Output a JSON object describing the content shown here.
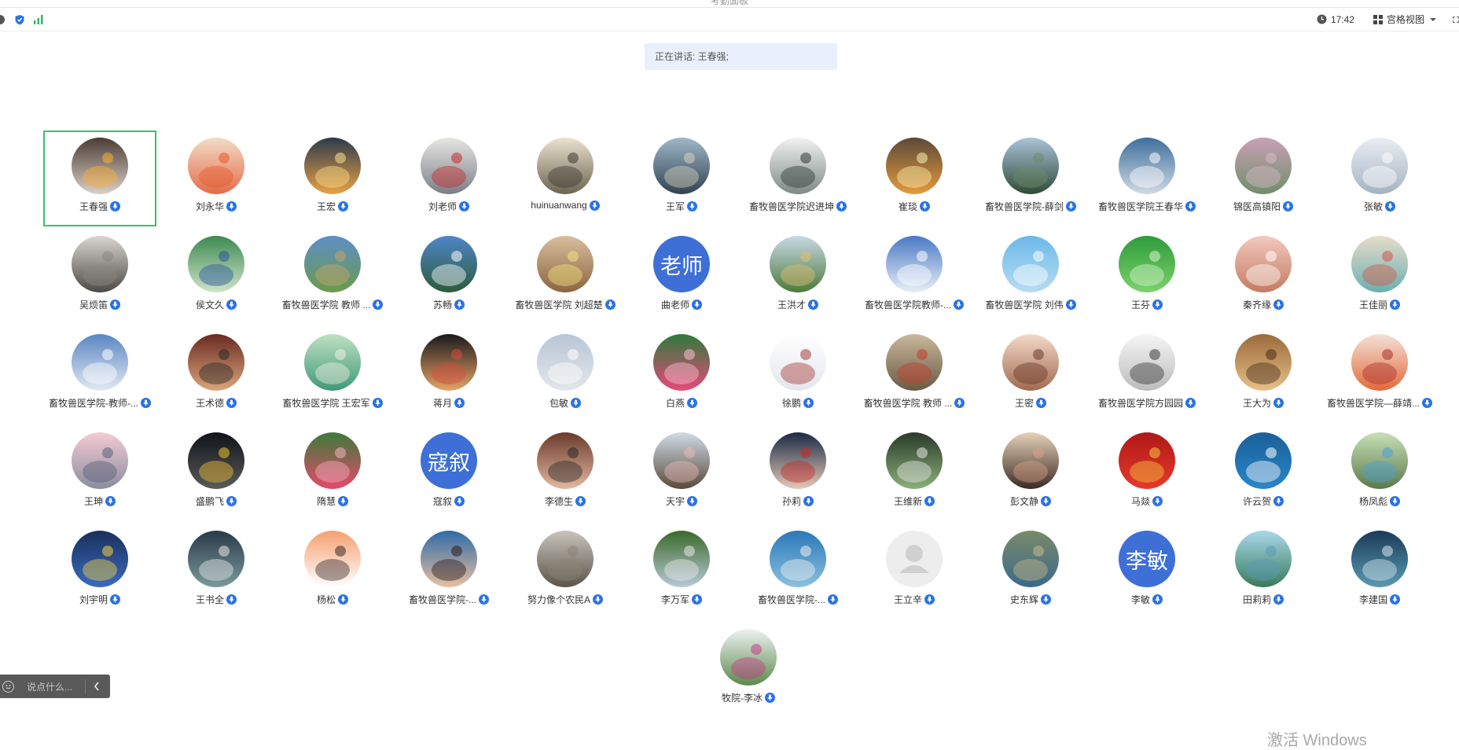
{
  "window": {
    "title": "考勤面板"
  },
  "toolbar": {
    "left_icons": [
      "info-icon",
      "shield-icon",
      "signal-icon"
    ],
    "time": "17:42",
    "view_mode": "宫格视图"
  },
  "banner": {
    "speaking": "正在讲话: 王春强;"
  },
  "participants": [
    {
      "name": "王春强",
      "avatar": {
        "type": "image",
        "c1": "#4a3d35",
        "c2": "#d9d0c8",
        "accent": "#ffb02e"
      }
    },
    {
      "name": "刘永华",
      "avatar": {
        "type": "image",
        "c1": "#f3dcc7",
        "c2": "#e36c4a",
        "accent": "#e65c2c"
      }
    },
    {
      "name": "王宏",
      "avatar": {
        "type": "image",
        "c1": "#2d3a4c",
        "c2": "#e8a145",
        "accent": "#ffe08a"
      }
    },
    {
      "name": "刘老师",
      "avatar": {
        "type": "image",
        "c1": "#e8e6e3",
        "c2": "#7a7f86",
        "accent": "#c52a2a"
      }
    },
    {
      "name": "huinuanwang",
      "avatar": {
        "type": "image",
        "c1": "#ebe3cf",
        "c2": "#6c6352",
        "accent": "#3e3a33"
      }
    },
    {
      "name": "王军",
      "avatar": {
        "type": "image",
        "c1": "#9fb8c8",
        "c2": "#314253",
        "accent": "#d8d0b8"
      }
    },
    {
      "name": "畜牧兽医学院迟进坤",
      "avatar": {
        "type": "image",
        "c1": "#f2f2f2",
        "c2": "#7d8a85",
        "accent": "#2d3a35"
      }
    },
    {
      "name": "崔琰",
      "avatar": {
        "type": "image",
        "c1": "#5c4a3a",
        "c2": "#e39a3c",
        "accent": "#fff0b0"
      }
    },
    {
      "name": "畜牧兽医学院-薛剑",
      "avatar": {
        "type": "image",
        "c1": "#aac4d9",
        "c2": "#2f4a37",
        "accent": "#6f8c6a"
      }
    },
    {
      "name": "畜牧兽医学院王春华",
      "avatar": {
        "type": "image",
        "c1": "#3f6f9c",
        "c2": "#cfd9e3",
        "accent": "#ffffff"
      }
    },
    {
      "name": "锦医高镇阳",
      "avatar": {
        "type": "image",
        "c1": "#c9a0b4",
        "c2": "#6f8f6a",
        "accent": "#d7b8c8"
      }
    },
    {
      "name": "张敏",
      "avatar": {
        "type": "image",
        "c1": "#e9eef3",
        "c2": "#a4b3c2",
        "accent": "#ffffff"
      }
    },
    {
      "name": "吴烦笛",
      "avatar": {
        "type": "image",
        "c1": "#d9d5cf",
        "c2": "#4d4a46",
        "accent": "#8a8782"
      }
    },
    {
      "name": "侯文久",
      "avatar": {
        "type": "image",
        "c1": "#3e8a52",
        "c2": "#cfe3c8",
        "accent": "#2a55a0"
      }
    },
    {
      "name": "畜牧兽医学院 教师 ...",
      "avatar": {
        "type": "image",
        "c1": "#5d8fc7",
        "c2": "#6a9a4a",
        "accent": "#c9a36b"
      }
    },
    {
      "name": "苏畅",
      "avatar": {
        "type": "image",
        "c1": "#4f86c9",
        "c2": "#2c5b3a",
        "accent": "#ffffff"
      }
    },
    {
      "name": "畜牧兽医学院 刘超楚",
      "avatar": {
        "type": "image",
        "c1": "#d8bf9e",
        "c2": "#8c6440",
        "accent": "#f3e27a"
      }
    },
    {
      "name": "曲老师",
      "avatar": {
        "type": "text",
        "text": "老师",
        "c1": "#3d6fd6",
        "c2": "#3d6fd6",
        "accent": "#ffffff"
      }
    },
    {
      "name": "王洪才",
      "avatar": {
        "type": "image",
        "c1": "#c8d9e6",
        "c2": "#4c7a3a",
        "accent": "#e0c070"
      }
    },
    {
      "name": "畜牧兽医学院教师-...",
      "avatar": {
        "type": "image",
        "c1": "#4a79c4",
        "c2": "#e7eef8",
        "accent": "#ffffff"
      }
    },
    {
      "name": "畜牧兽医学院 刘伟",
      "avatar": {
        "type": "image",
        "c1": "#6cb8e8",
        "c2": "#b7ddf3",
        "accent": "#ffffff"
      }
    },
    {
      "name": "王芬",
      "avatar": {
        "type": "image",
        "c1": "#2f9a3c",
        "c2": "#7bd36a",
        "accent": "#d8f3cf"
      }
    },
    {
      "name": "秦齐缘",
      "avatar": {
        "type": "image",
        "c1": "#f2c9c0",
        "c2": "#c47b60",
        "accent": "#ffffff"
      }
    },
    {
      "name": "王佳丽",
      "avatar": {
        "type": "image",
        "c1": "#e6dccb",
        "c2": "#6ab0b0",
        "accent": "#d2584a"
      }
    },
    {
      "name": "畜牧兽医学院-教师-...",
      "avatar": {
        "type": "image",
        "c1": "#5b86c4",
        "c2": "#e2e9f2",
        "accent": "#ffffff"
      }
    },
    {
      "name": "王术德",
      "avatar": {
        "type": "image",
        "c1": "#6a2a22",
        "c2": "#d9a77a",
        "accent": "#2a2a2a"
      }
    },
    {
      "name": "畜牧兽医学院 王宏军",
      "avatar": {
        "type": "image",
        "c1": "#bfe0c3",
        "c2": "#3e9a78",
        "accent": "#f4efe0"
      }
    },
    {
      "name": "蒋月",
      "avatar": {
        "type": "image",
        "c1": "#1a1a1a",
        "c2": "#e8a368",
        "accent": "#d84a3a"
      }
    },
    {
      "name": "包敏",
      "avatar": {
        "type": "image",
        "c1": "#b9c6d6",
        "c2": "#e2e6ea",
        "accent": "#ffffff"
      }
    },
    {
      "name": "白燕",
      "avatar": {
        "type": "image",
        "c1": "#2f7a3c",
        "c2": "#e64a7a",
        "accent": "#ffc0d0"
      }
    },
    {
      "name": "徐鹏",
      "avatar": {
        "type": "image",
        "c1": "#ffffff",
        "c2": "#e3e6ea",
        "accent": "#a83a3a"
      }
    },
    {
      "name": "畜牧兽医学院 教师 ...",
      "avatar": {
        "type": "image",
        "c1": "#c9b89c",
        "c2": "#6b5a44",
        "accent": "#c43c2c"
      }
    },
    {
      "name": "王密",
      "avatar": {
        "type": "image",
        "c1": "#f4d8c8",
        "c2": "#a06b50",
        "accent": "#6a3a2a"
      }
    },
    {
      "name": "畜牧兽医学院方园园",
      "avatar": {
        "type": "image",
        "c1": "#f5f5f5",
        "c2": "#bcbcbc",
        "accent": "#3a3a3a"
      }
    },
    {
      "name": "王大为",
      "avatar": {
        "type": "image",
        "c1": "#9a6b3a",
        "c2": "#e8c08a",
        "accent": "#4a2f1a"
      }
    },
    {
      "name": "畜牧兽医学院—薛靖...",
      "avatar": {
        "type": "image",
        "c1": "#f3e1d6",
        "c2": "#e26a3a",
        "accent": "#a83030"
      }
    },
    {
      "name": "王珅",
      "avatar": {
        "type": "image",
        "c1": "#f4cbd3",
        "c2": "#8a8ea0",
        "accent": "#5a5e78"
      }
    },
    {
      "name": "盛鹏飞",
      "avatar": {
        "type": "image",
        "c1": "#101418",
        "c2": "#5a5a5a",
        "accent": "#f1c232"
      }
    },
    {
      "name": "隋慧",
      "avatar": {
        "type": "image",
        "c1": "#3c7a3a",
        "c2": "#e64a6a",
        "accent": "#f7b0c0"
      }
    },
    {
      "name": "寇叙",
      "avatar": {
        "type": "text",
        "text": "寇叙",
        "c1": "#3d6fd6",
        "c2": "#3d6fd6",
        "accent": "#ffffff"
      }
    },
    {
      "name": "李德生",
      "avatar": {
        "type": "image",
        "c1": "#6b3a2a",
        "c2": "#e3b8a0",
        "accent": "#2a2a2a"
      }
    },
    {
      "name": "天宇",
      "avatar": {
        "type": "image",
        "c1": "#cfdbe6",
        "c2": "#5a4a3a",
        "accent": "#e8b8b8"
      }
    },
    {
      "name": "孙莉",
      "avatar": {
        "type": "image",
        "c1": "#1a2a44",
        "c2": "#e6c9b8",
        "accent": "#c42a2a"
      }
    },
    {
      "name": "王维新",
      "avatar": {
        "type": "image",
        "c1": "#2a3a2a",
        "c2": "#8ab07a",
        "accent": "#e8e8e8"
      }
    },
    {
      "name": "彭文静",
      "avatar": {
        "type": "image",
        "c1": "#e6d2b8",
        "c2": "#3a2a22",
        "accent": "#d8a088"
      }
    },
    {
      "name": "马燚",
      "avatar": {
        "type": "image",
        "c1": "#b01818",
        "c2": "#e63a2a",
        "accent": "#f5c842"
      }
    },
    {
      "name": "许云贺",
      "avatar": {
        "type": "image",
        "c1": "#1a5f9a",
        "c2": "#2a86c8",
        "accent": "#ffffff"
      }
    },
    {
      "name": "杨凤彪",
      "avatar": {
        "type": "image",
        "c1": "#c8e0b8",
        "c2": "#5a7a4a",
        "accent": "#4aa0d8"
      }
    },
    {
      "name": "刘宇明",
      "avatar": {
        "type": "image",
        "c1": "#1a2f5a",
        "c2": "#3a6ac0",
        "accent": "#f5d442"
      }
    },
    {
      "name": "王书全",
      "avatar": {
        "type": "image",
        "c1": "#2a3a4a",
        "c2": "#7a9a9a",
        "accent": "#e8e8e8"
      }
    },
    {
      "name": "杨松",
      "avatar": {
        "type": "image",
        "c1": "#f5a070",
        "c2": "#ffffff",
        "accent": "#3a2a2a"
      }
    },
    {
      "name": "畜牧兽医学院-...",
      "avatar": {
        "type": "image",
        "c1": "#2f6aa8",
        "c2": "#e8c0a0",
        "accent": "#2a1a1a"
      }
    },
    {
      "name": "努力像个农民A",
      "avatar": {
        "type": "image",
        "c1": "#c8c4bc",
        "c2": "#5a5448",
        "accent": "#8a8478"
      }
    },
    {
      "name": "李万军",
      "avatar": {
        "type": "image",
        "c1": "#3a6a2a",
        "c2": "#b8c8d8",
        "accent": "#e8e8e8"
      }
    },
    {
      "name": "畜牧兽医学院-...",
      "avatar": {
        "type": "image",
        "c1": "#2a78b8",
        "c2": "#8ac0e0",
        "accent": "#f0f0f0"
      }
    },
    {
      "name": "王立辛",
      "avatar": {
        "type": "placeholder",
        "c1": "#eeeeee",
        "c2": "#d0d0d0",
        "accent": "#cfcfcf"
      }
    },
    {
      "name": "史东辉",
      "avatar": {
        "type": "image",
        "c1": "#7a8a6a",
        "c2": "#3a6a8a",
        "accent": "#c8b88a"
      }
    },
    {
      "name": "李敏",
      "avatar": {
        "type": "text",
        "text": "李敏",
        "c1": "#3d6fd6",
        "c2": "#3d6fd6",
        "accent": "#ffffff"
      }
    },
    {
      "name": "田莉莉",
      "avatar": {
        "type": "image",
        "c1": "#a8d8e8",
        "c2": "#3a7a5a",
        "accent": "#5a9ab8"
      }
    },
    {
      "name": "李建国",
      "avatar": {
        "type": "image",
        "c1": "#1a3a5a",
        "c2": "#5a9ab0",
        "accent": "#d8e8f0"
      }
    }
  ],
  "last_participant": {
    "name": "牧院-李冰",
    "avatar": {
      "type": "image",
      "c1": "#eef2f3",
      "c2": "#5a8a4a",
      "accent": "#c83a8a"
    }
  },
  "chat": {
    "placeholder": "说点什么..."
  },
  "watermark": "激活 Windows"
}
